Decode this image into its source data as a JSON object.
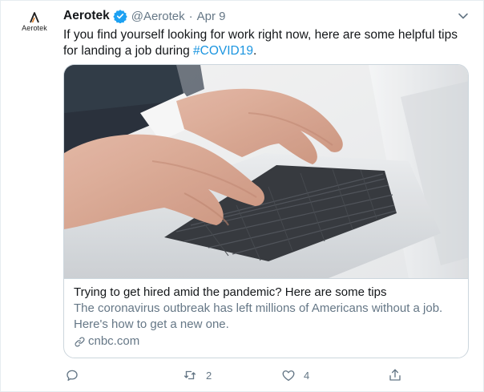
{
  "tweet": {
    "author_name": "Aerotek",
    "author_handle": "@Aerotek",
    "separator": "·",
    "date": "Apr 9",
    "avatar_brand": "Aerotek",
    "text_main": "If you find yourself looking for work right now, here are some helpful tips for landing a job during ",
    "hashtag": "#COVID19",
    "text_end": "."
  },
  "card": {
    "title": "Trying to get hired amid the pandemic? Here are some tips",
    "description": "The coronavirus outbreak has left millions of Americans without a job. Here's how to get a new one.",
    "domain": "cnbc.com",
    "image_subject": "hands typing on a laptop keyboard"
  },
  "actions": {
    "reply_count": "",
    "retweet_count": "2",
    "like_count": "4"
  },
  "icons": {
    "verified": "verified-badge-icon",
    "menu": "chevron-down-icon",
    "reply": "reply-icon",
    "retweet": "retweet-icon",
    "like": "heart-icon",
    "share": "share-icon",
    "link": "link-icon"
  },
  "colors": {
    "accent": "#1da1f2",
    "hashtag": "#1b95e0",
    "secondary_text": "#657786",
    "primary_text": "#14171a",
    "border": "#ccd6dd"
  }
}
